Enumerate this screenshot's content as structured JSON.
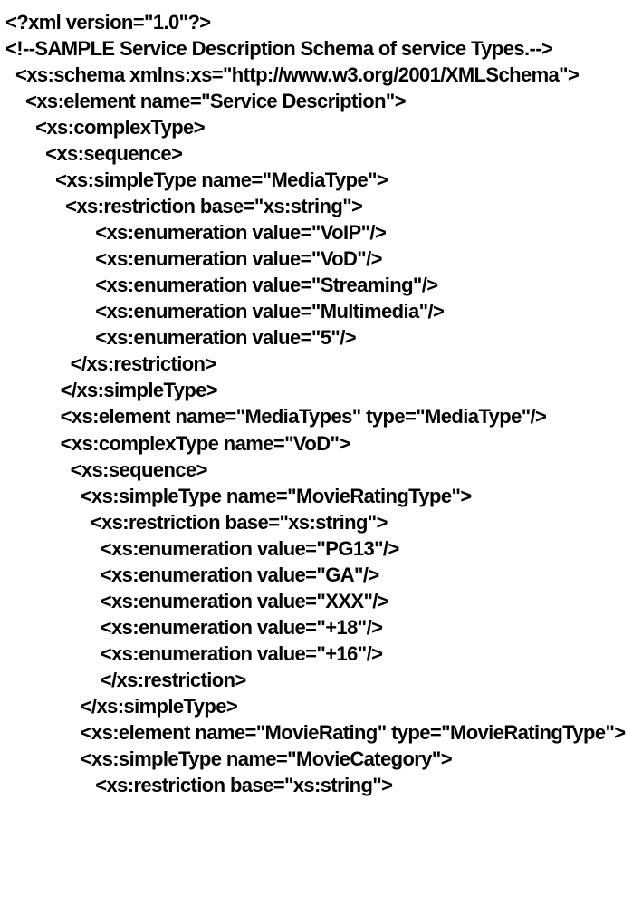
{
  "code": {
    "lines": [
      "<?xml version=\"1.0\"?>",
      "<!--SAMPLE Service Description Schema of service Types.-->",
      "  <xs:schema xmlns:xs=\"http://www.w3.org/2001/XMLSchema\">",
      "    <xs:element name=\"Service Description\">",
      "      <xs:complexType>",
      "        <xs:sequence>",
      "          <xs:simpleType name=\"MediaType\">",
      "            <xs:restriction base=\"xs:string\">",
      "                  <xs:enumeration value=\"VoIP\"/>",
      "                  <xs:enumeration value=\"VoD\"/>",
      "                  <xs:enumeration value=\"Streaming\"/>",
      "                  <xs:enumeration value=\"Multimedia\"/>",
      "                  <xs:enumeration value=\"5\"/>",
      "             </xs:restriction>",
      "           </xs:simpleType>",
      "           <xs:element name=\"MediaTypes\" type=\"MediaType\"/>",
      "           <xs:complexType name=\"VoD\">",
      "             <xs:sequence>",
      "               <xs:simpleType name=\"MovieRatingType\">",
      "                 <xs:restriction base=\"xs:string\">",
      "                   <xs:enumeration value=\"PG13\"/>",
      "                   <xs:enumeration value=\"GA\"/>",
      "                   <xs:enumeration value=\"XXX\"/>",
      "                   <xs:enumeration value=\"+18\"/>",
      "                   <xs:enumeration value=\"+16\"/>",
      "                   </xs:restriction>",
      "               </xs:simpleType>",
      "               <xs:element name=\"MovieRating\" type=\"MovieRatingType\">",
      "               <xs:simpleType name=\"MovieCategory\">",
      "                  <xs:restriction base=\"xs:string\">"
    ]
  }
}
